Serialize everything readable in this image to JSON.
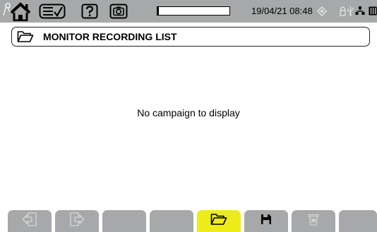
{
  "status_bar": {
    "datetime": "19/04/21 08:48",
    "progress_fraction": 0.02,
    "icons": [
      "home-icon",
      "list-check-icon",
      "help-icon",
      "camera-icon",
      "gps-diamond-icon",
      "lock-icon",
      "usb-icon",
      "network-icon",
      "battery-icon"
    ]
  },
  "header": {
    "title": "MONITOR RECORDING LIST",
    "icon": "folder-open-icon"
  },
  "main": {
    "empty_message": "No campaign to display"
  },
  "function_keys": {
    "icons": [
      "exit-left-icon",
      "exit-right-icon",
      "",
      "",
      "folder-open-icon",
      "save-icon",
      "trash-icon",
      ""
    ],
    "active_index": 4
  },
  "colors": {
    "bar": "#a6a8a9",
    "active_key": "#ecec1a"
  }
}
